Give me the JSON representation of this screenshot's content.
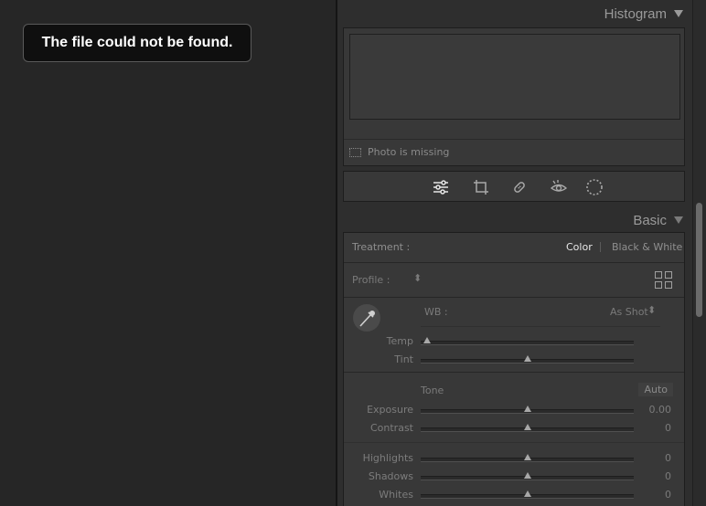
{
  "toast": {
    "message": "The file could not be found."
  },
  "histogram": {
    "title": "Histogram",
    "status": "Photo is missing"
  },
  "tools": [
    "sliders-icon",
    "crop-icon",
    "healing-icon",
    "redeye-icon",
    "mask-icon"
  ],
  "basic": {
    "title": "Basic",
    "treatment": {
      "label": "Treatment :",
      "options": [
        "Color",
        "Black & White"
      ],
      "selected": "Color"
    },
    "profile": {
      "label": "Profile :"
    },
    "wb": {
      "label": "WB :",
      "value": "As Shot"
    },
    "sliders_wb": [
      {
        "label": "Temp",
        "value": "",
        "position": 0.03
      },
      {
        "label": "Tint",
        "value": "",
        "position": 0.5
      }
    ],
    "tone": {
      "label": "Tone",
      "auto": "Auto"
    },
    "sliders_tone": [
      {
        "label": "Exposure",
        "value": "0.00",
        "position": 0.5
      },
      {
        "label": "Contrast",
        "value": "0",
        "position": 0.5
      }
    ],
    "sliders_presence": [
      {
        "label": "Highlights",
        "value": "0",
        "position": 0.5
      },
      {
        "label": "Shadows",
        "value": "0",
        "position": 0.5
      },
      {
        "label": "Whites",
        "value": "0",
        "position": 0.5
      }
    ]
  },
  "colors": {
    "background": "#262626",
    "panel": "#383838",
    "text": "#bdbdbd"
  }
}
